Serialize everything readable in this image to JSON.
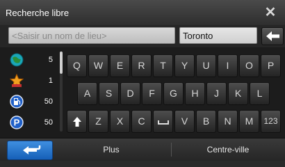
{
  "header": {
    "title": "Recherche libre",
    "close_icon": "close-icon"
  },
  "search": {
    "placeholder": "<Saisir un nom de lieu>",
    "city": "Toronto"
  },
  "sidebar": {
    "items": [
      {
        "icon": "globe-icon",
        "count": "5"
      },
      {
        "icon": "star-icon",
        "count": "1"
      },
      {
        "icon": "gas-station-icon",
        "count": "50"
      },
      {
        "icon": "parking-icon",
        "count": "50"
      }
    ]
  },
  "keyboard": {
    "row1": [
      "Q",
      "W",
      "E",
      "R",
      "T",
      "Y",
      "U",
      "I",
      "O",
      "P"
    ],
    "row2": [
      "A",
      "S",
      "D",
      "F",
      "G",
      "H",
      "J",
      "K",
      "L"
    ],
    "row3": [
      "Z",
      "X",
      "C",
      "V",
      "B",
      "N",
      "M",
      "123"
    ]
  },
  "bottom": {
    "plus_label": "Plus",
    "centre_label": "Centre-ville"
  },
  "colors": {
    "accent": "#1f6fd0"
  }
}
